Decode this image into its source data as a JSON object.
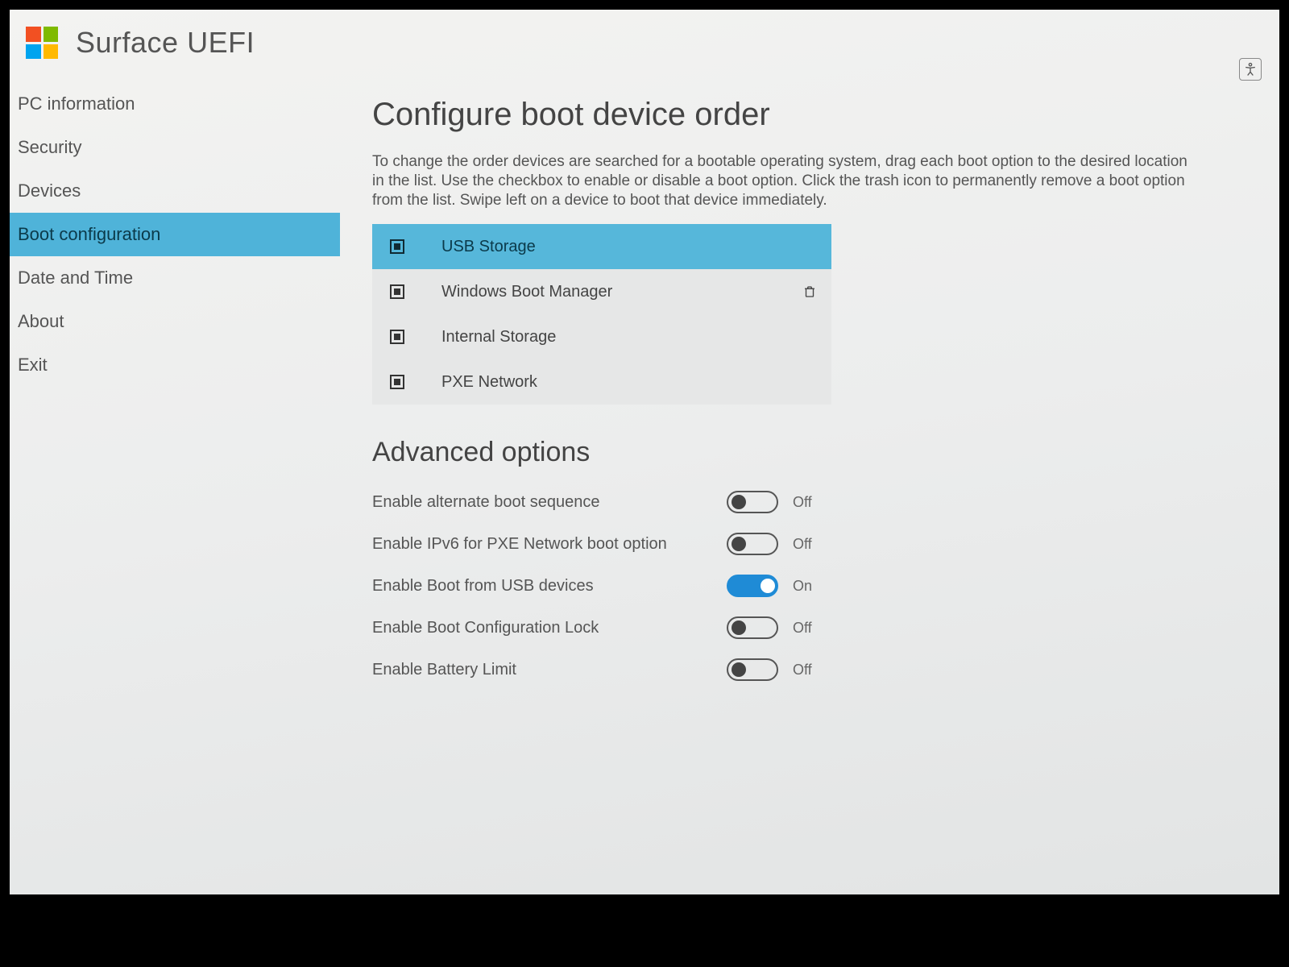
{
  "header": {
    "title": "Surface UEFI",
    "accessibility_icon": "accessibility"
  },
  "sidebar": {
    "items": [
      {
        "label": "PC information",
        "active": false
      },
      {
        "label": "Security",
        "active": false
      },
      {
        "label": "Devices",
        "active": false
      },
      {
        "label": "Boot configuration",
        "active": true
      },
      {
        "label": "Date and Time",
        "active": false
      },
      {
        "label": "About",
        "active": false
      },
      {
        "label": "Exit",
        "active": false
      }
    ]
  },
  "main": {
    "title": "Configure boot device order",
    "description": "To change the order devices are searched for a bootable operating system, drag each boot option to the desired location in the list.  Use the checkbox to enable or disable a boot option.  Click the trash icon to permanently remove a boot option from the list.  Swipe left on a device to boot that device immediately.",
    "boot_devices": [
      {
        "label": "USB Storage",
        "checked": true,
        "selected": true,
        "has_trash": false
      },
      {
        "label": "Windows Boot Manager",
        "checked": true,
        "selected": false,
        "has_trash": true
      },
      {
        "label": "Internal Storage",
        "checked": true,
        "selected": false,
        "has_trash": false
      },
      {
        "label": "PXE Network",
        "checked": true,
        "selected": false,
        "has_trash": false
      }
    ],
    "advanced_title": "Advanced options",
    "advanced_options": [
      {
        "label": "Enable alternate boot sequence",
        "on": false,
        "state": "Off"
      },
      {
        "label": "Enable IPv6 for PXE Network boot option",
        "on": false,
        "state": "Off"
      },
      {
        "label": "Enable Boot from USB devices",
        "on": true,
        "state": "On"
      },
      {
        "label": "Enable Boot Configuration Lock",
        "on": false,
        "state": "Off"
      },
      {
        "label": "Enable Battery Limit",
        "on": false,
        "state": "Off"
      }
    ]
  }
}
